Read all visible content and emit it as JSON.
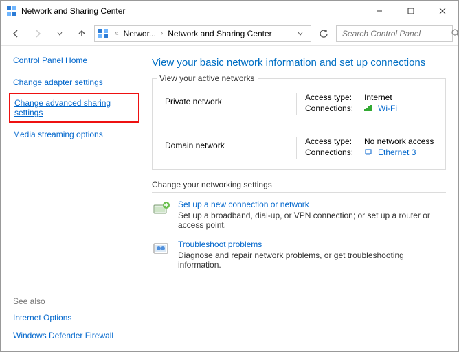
{
  "window": {
    "title": "Network and Sharing Center"
  },
  "breadcrumb": {
    "seg1": "Networ...",
    "seg2": "Network and Sharing Center"
  },
  "search": {
    "placeholder": "Search Control Panel"
  },
  "sidebar": {
    "home": "Control Panel Home",
    "link_adapter": "Change adapter settings",
    "link_sharing": "Change advanced sharing settings",
    "link_media": "Media streaming options",
    "seealso_header": "See also",
    "seealso_internet": "Internet Options",
    "seealso_firewall": "Windows Defender Firewall"
  },
  "panel": {
    "heading": "View your basic network information and set up connections",
    "active_legend": "View your active networks",
    "networks": [
      {
        "name": "Private network",
        "access_label": "Access type:",
        "access_value": "Internet",
        "conn_label": "Connections:",
        "conn_value": "Wi-Fi",
        "conn_icon": "wifi"
      },
      {
        "name": "Domain network",
        "access_label": "Access type:",
        "access_value": "No network access",
        "conn_label": "Connections:",
        "conn_value": "Ethernet 3",
        "conn_icon": "ethernet"
      }
    ],
    "change_head": "Change your networking settings",
    "actions": [
      {
        "title": "Set up a new connection or network",
        "desc": "Set up a broadband, dial-up, or VPN connection; or set up a router or access point."
      },
      {
        "title": "Troubleshoot problems",
        "desc": "Diagnose and repair network problems, or get troubleshooting information."
      }
    ]
  }
}
